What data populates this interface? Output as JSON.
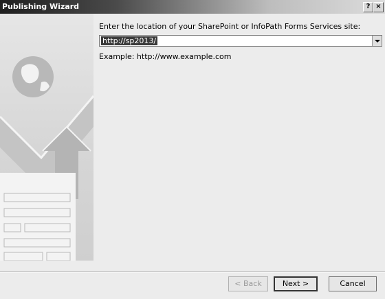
{
  "window": {
    "title": "Publishing Wizard",
    "help_glyph": "?",
    "close_glyph": "×"
  },
  "main": {
    "prompt": "Enter the location of your SharePoint or InfoPath Forms Services site:",
    "location_value": "http://sp2013/",
    "example": "Example: http://www.example.com"
  },
  "buttons": {
    "back": "< Back",
    "next": "Next >",
    "cancel": "Cancel"
  },
  "colors": {
    "titlebar_dark": "#1f1f1f",
    "selection": "#3a3a3a",
    "dialog_bg": "#ececec"
  }
}
